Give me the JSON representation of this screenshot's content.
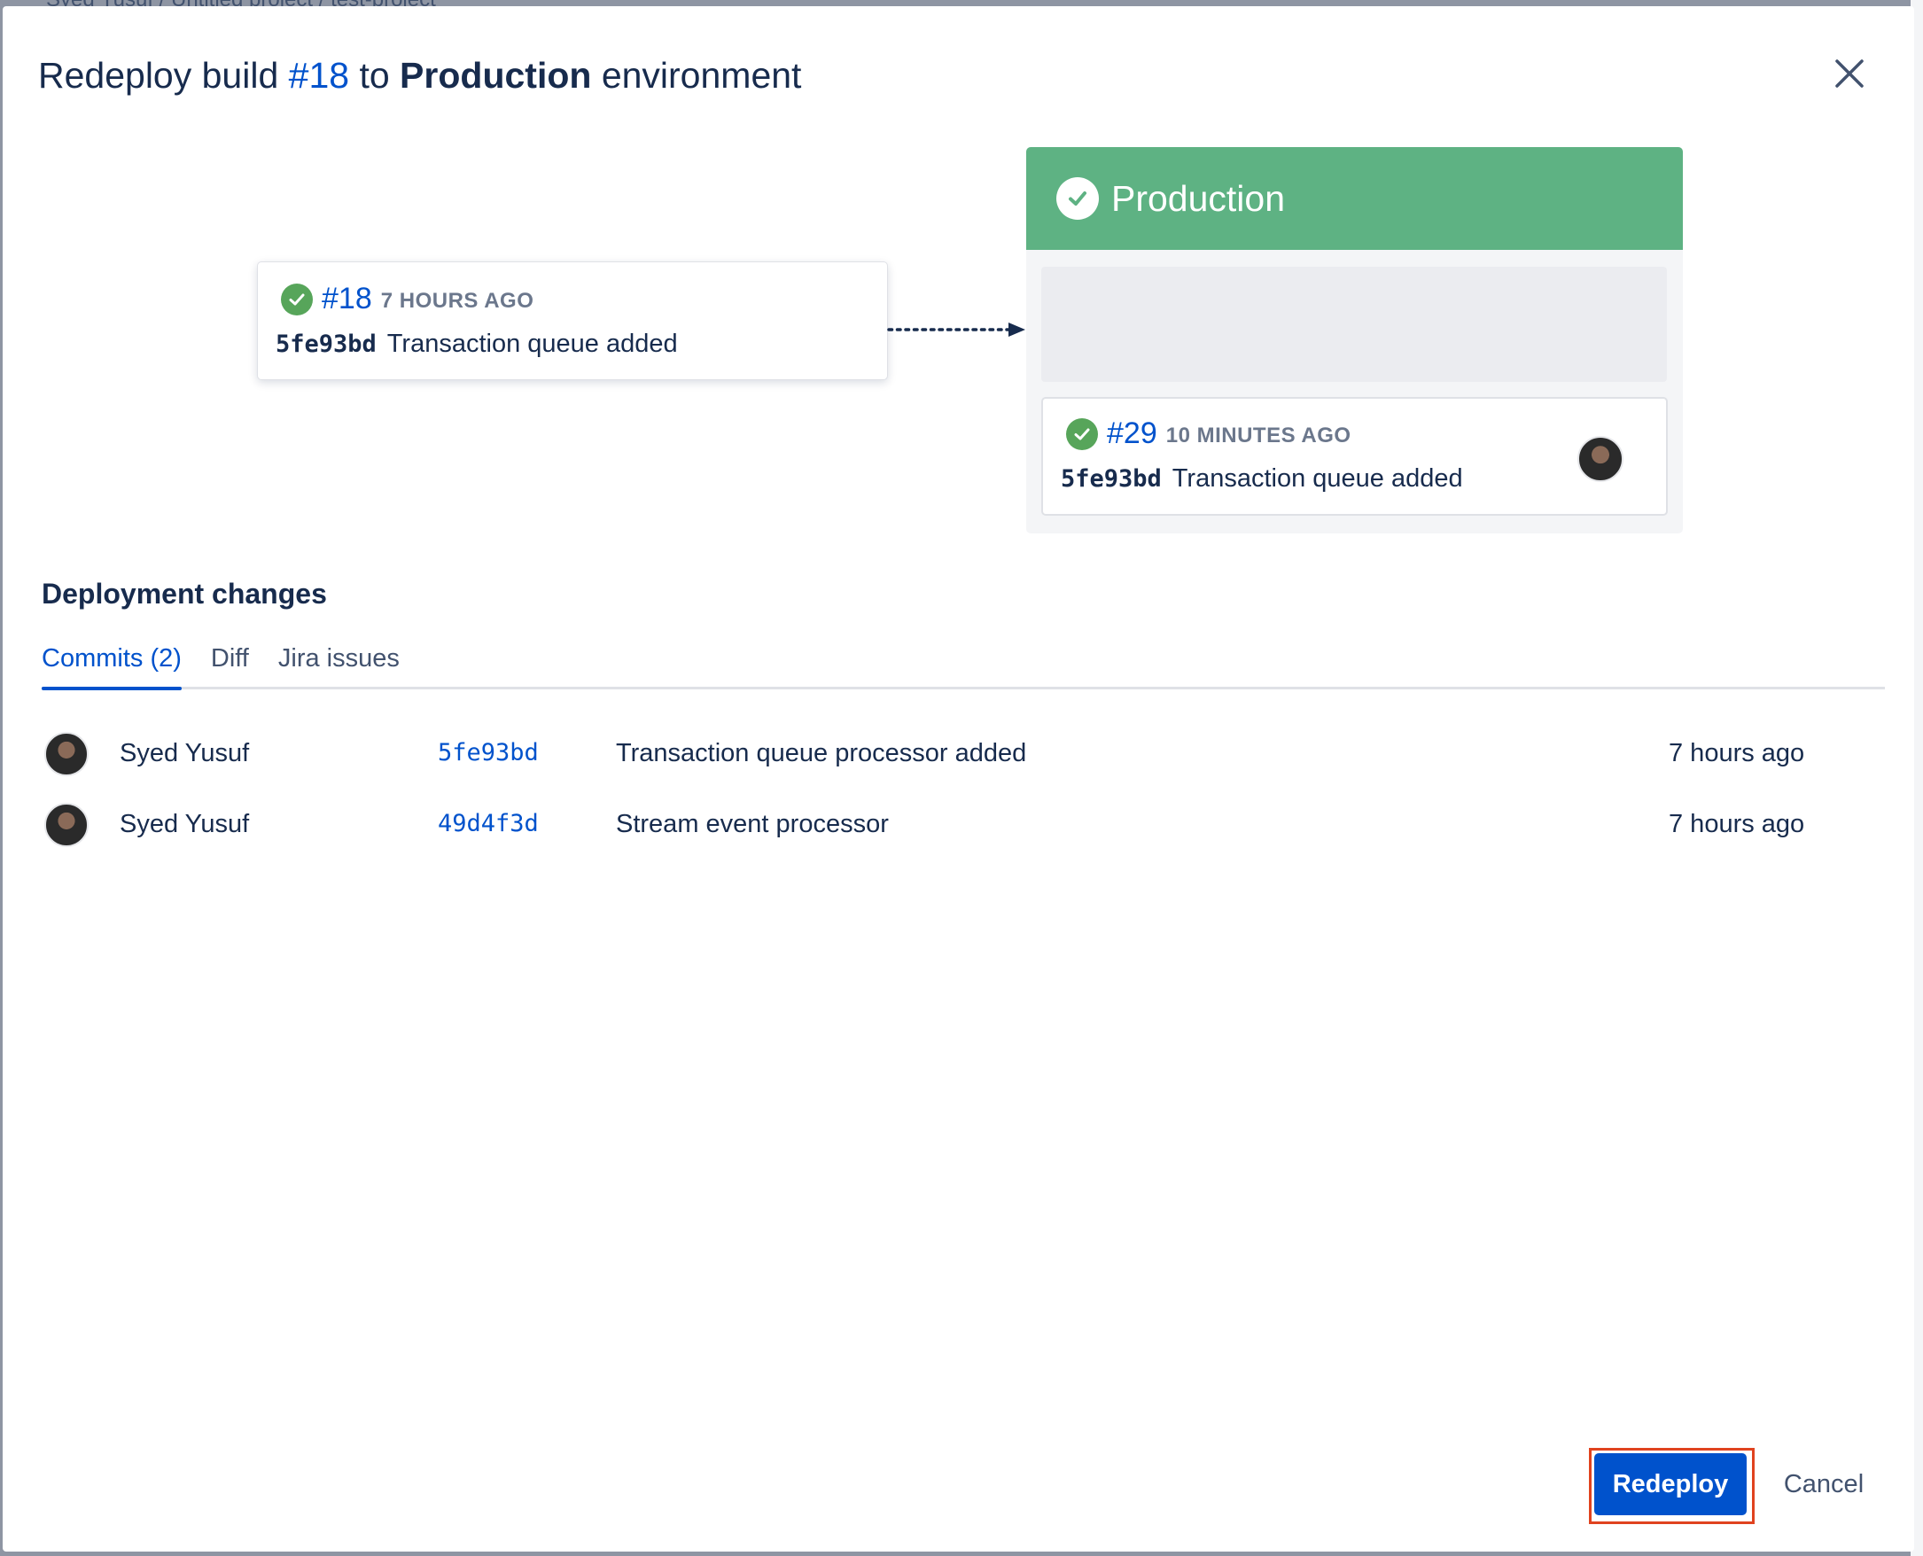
{
  "background": {
    "breadcrumb": "Syed Yusuf  /  Untitled project  /  test-project"
  },
  "dialog": {
    "title_prefix": "Redeploy build ",
    "title_build": "#18",
    "title_mid": " to ",
    "title_env": "Production",
    "title_suffix": " environment",
    "close_icon": "close-icon"
  },
  "source_build": {
    "status_icon": "check-circle-icon",
    "number": "#18",
    "time": "7 HOURS AGO",
    "commit_hash": "5fe93bd",
    "commit_message": "Transaction queue added"
  },
  "environment": {
    "name": "Production",
    "status_icon": "check-circle-icon",
    "header_color": "#5eb283",
    "current_build": {
      "status_icon": "check-circle-icon",
      "number": "#29",
      "time": "10 MINUTES AGO",
      "commit_hash": "5fe93bd",
      "commit_message": "Transaction queue added"
    }
  },
  "changes": {
    "title": "Deployment changes",
    "tabs": [
      {
        "label": "Commits (2)",
        "active": true
      },
      {
        "label": "Diff",
        "active": false
      },
      {
        "label": "Jira issues",
        "active": false
      }
    ],
    "commits": [
      {
        "author": "Syed Yusuf",
        "sha": "5fe93bd",
        "message": "Transaction queue processor added",
        "time": "7 hours ago"
      },
      {
        "author": "Syed Yusuf",
        "sha": "49d4f3d",
        "message": "Stream event processor",
        "time": "7 hours ago"
      }
    ]
  },
  "footer": {
    "redeploy_label": "Redeploy",
    "cancel_label": "Cancel",
    "primary_color": "#0052cc",
    "highlight_color": "#e0431f"
  }
}
